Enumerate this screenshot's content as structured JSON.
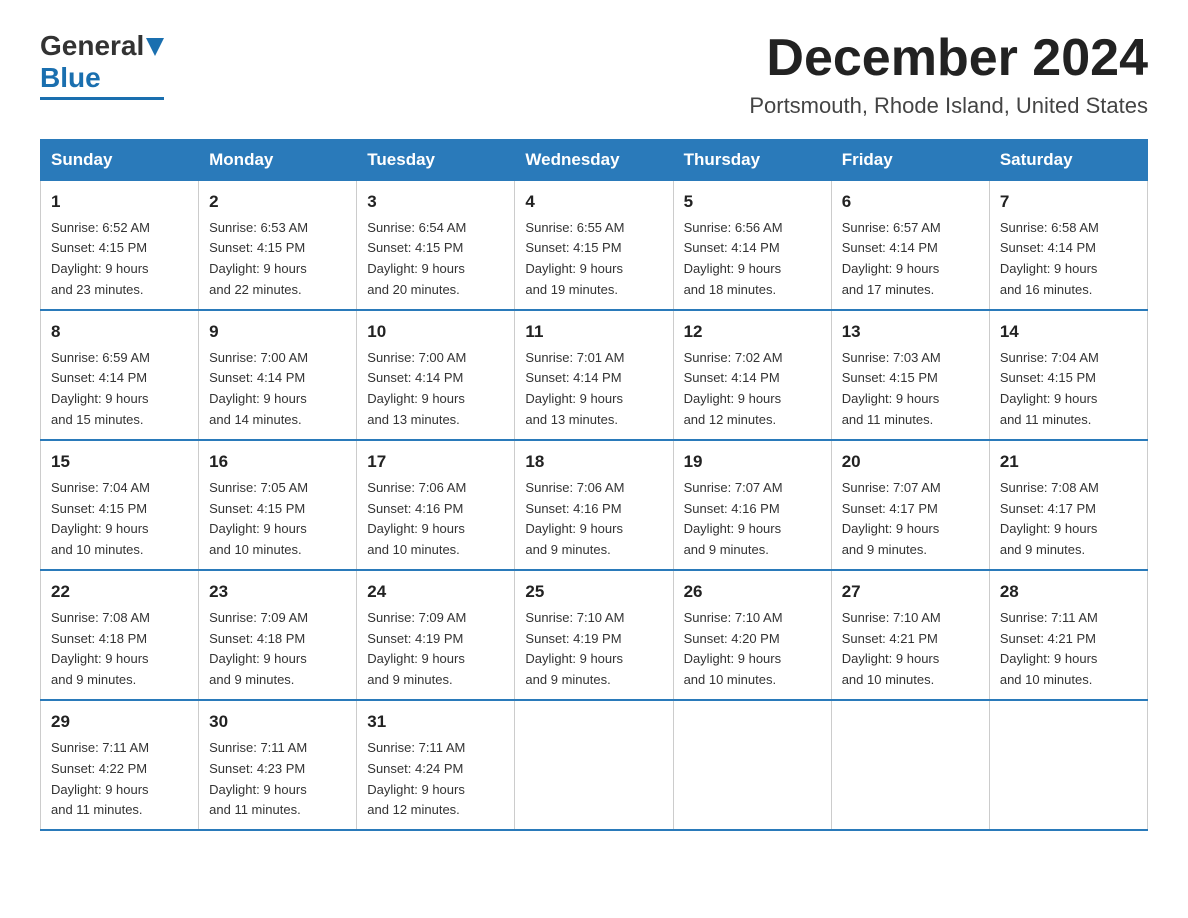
{
  "header": {
    "logo_general": "General",
    "logo_blue": "Blue",
    "title": "December 2024",
    "subtitle": "Portsmouth, Rhode Island, United States"
  },
  "days_of_week": [
    "Sunday",
    "Monday",
    "Tuesday",
    "Wednesday",
    "Thursday",
    "Friday",
    "Saturday"
  ],
  "weeks": [
    [
      {
        "day": "1",
        "sunrise": "6:52 AM",
        "sunset": "4:15 PM",
        "daylight": "9 hours and 23 minutes."
      },
      {
        "day": "2",
        "sunrise": "6:53 AM",
        "sunset": "4:15 PM",
        "daylight": "9 hours and 22 minutes."
      },
      {
        "day": "3",
        "sunrise": "6:54 AM",
        "sunset": "4:15 PM",
        "daylight": "9 hours and 20 minutes."
      },
      {
        "day": "4",
        "sunrise": "6:55 AM",
        "sunset": "4:15 PM",
        "daylight": "9 hours and 19 minutes."
      },
      {
        "day": "5",
        "sunrise": "6:56 AM",
        "sunset": "4:14 PM",
        "daylight": "9 hours and 18 minutes."
      },
      {
        "day": "6",
        "sunrise": "6:57 AM",
        "sunset": "4:14 PM",
        "daylight": "9 hours and 17 minutes."
      },
      {
        "day": "7",
        "sunrise": "6:58 AM",
        "sunset": "4:14 PM",
        "daylight": "9 hours and 16 minutes."
      }
    ],
    [
      {
        "day": "8",
        "sunrise": "6:59 AM",
        "sunset": "4:14 PM",
        "daylight": "9 hours and 15 minutes."
      },
      {
        "day": "9",
        "sunrise": "7:00 AM",
        "sunset": "4:14 PM",
        "daylight": "9 hours and 14 minutes."
      },
      {
        "day": "10",
        "sunrise": "7:00 AM",
        "sunset": "4:14 PM",
        "daylight": "9 hours and 13 minutes."
      },
      {
        "day": "11",
        "sunrise": "7:01 AM",
        "sunset": "4:14 PM",
        "daylight": "9 hours and 13 minutes."
      },
      {
        "day": "12",
        "sunrise": "7:02 AM",
        "sunset": "4:14 PM",
        "daylight": "9 hours and 12 minutes."
      },
      {
        "day": "13",
        "sunrise": "7:03 AM",
        "sunset": "4:15 PM",
        "daylight": "9 hours and 11 minutes."
      },
      {
        "day": "14",
        "sunrise": "7:04 AM",
        "sunset": "4:15 PM",
        "daylight": "9 hours and 11 minutes."
      }
    ],
    [
      {
        "day": "15",
        "sunrise": "7:04 AM",
        "sunset": "4:15 PM",
        "daylight": "9 hours and 10 minutes."
      },
      {
        "day": "16",
        "sunrise": "7:05 AM",
        "sunset": "4:15 PM",
        "daylight": "9 hours and 10 minutes."
      },
      {
        "day": "17",
        "sunrise": "7:06 AM",
        "sunset": "4:16 PM",
        "daylight": "9 hours and 10 minutes."
      },
      {
        "day": "18",
        "sunrise": "7:06 AM",
        "sunset": "4:16 PM",
        "daylight": "9 hours and 9 minutes."
      },
      {
        "day": "19",
        "sunrise": "7:07 AM",
        "sunset": "4:16 PM",
        "daylight": "9 hours and 9 minutes."
      },
      {
        "day": "20",
        "sunrise": "7:07 AM",
        "sunset": "4:17 PM",
        "daylight": "9 hours and 9 minutes."
      },
      {
        "day": "21",
        "sunrise": "7:08 AM",
        "sunset": "4:17 PM",
        "daylight": "9 hours and 9 minutes."
      }
    ],
    [
      {
        "day": "22",
        "sunrise": "7:08 AM",
        "sunset": "4:18 PM",
        "daylight": "9 hours and 9 minutes."
      },
      {
        "day": "23",
        "sunrise": "7:09 AM",
        "sunset": "4:18 PM",
        "daylight": "9 hours and 9 minutes."
      },
      {
        "day": "24",
        "sunrise": "7:09 AM",
        "sunset": "4:19 PM",
        "daylight": "9 hours and 9 minutes."
      },
      {
        "day": "25",
        "sunrise": "7:10 AM",
        "sunset": "4:19 PM",
        "daylight": "9 hours and 9 minutes."
      },
      {
        "day": "26",
        "sunrise": "7:10 AM",
        "sunset": "4:20 PM",
        "daylight": "9 hours and 10 minutes."
      },
      {
        "day": "27",
        "sunrise": "7:10 AM",
        "sunset": "4:21 PM",
        "daylight": "9 hours and 10 minutes."
      },
      {
        "day": "28",
        "sunrise": "7:11 AM",
        "sunset": "4:21 PM",
        "daylight": "9 hours and 10 minutes."
      }
    ],
    [
      {
        "day": "29",
        "sunrise": "7:11 AM",
        "sunset": "4:22 PM",
        "daylight": "9 hours and 11 minutes."
      },
      {
        "day": "30",
        "sunrise": "7:11 AM",
        "sunset": "4:23 PM",
        "daylight": "9 hours and 11 minutes."
      },
      {
        "day": "31",
        "sunrise": "7:11 AM",
        "sunset": "4:24 PM",
        "daylight": "9 hours and 12 minutes."
      },
      null,
      null,
      null,
      null
    ]
  ],
  "labels": {
    "sunrise": "Sunrise:",
    "sunset": "Sunset:",
    "daylight": "Daylight:"
  }
}
